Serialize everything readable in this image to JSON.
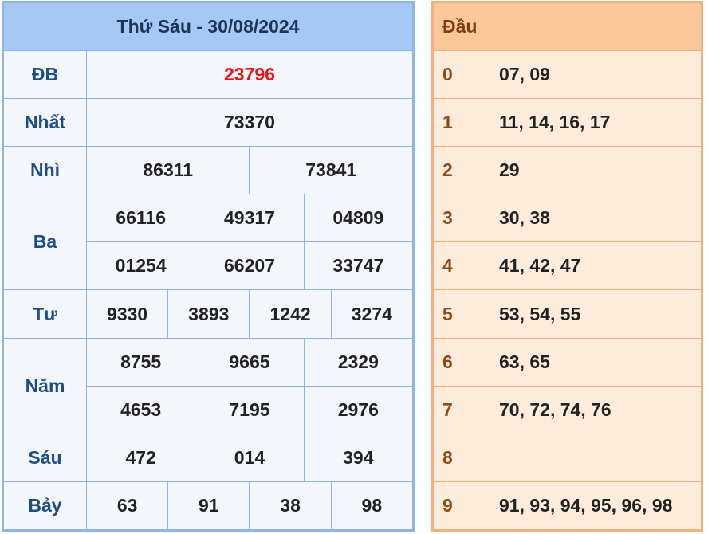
{
  "results": {
    "title": "Thứ Sáu - 30/08/2024",
    "db": {
      "label": "ĐB",
      "values": [
        "23796"
      ]
    },
    "nhat": {
      "label": "Nhất",
      "values": [
        "73370"
      ]
    },
    "nhi": {
      "label": "Nhì",
      "values": [
        "86311",
        "73841"
      ]
    },
    "ba": {
      "label": "Ba",
      "row1": [
        "66116",
        "49317",
        "04809"
      ],
      "row2": [
        "01254",
        "66207",
        "33747"
      ]
    },
    "tu": {
      "label": "Tư",
      "values": [
        "9330",
        "3893",
        "1242",
        "3274"
      ]
    },
    "nam": {
      "label": "Năm",
      "row1": [
        "8755",
        "9665",
        "2329"
      ],
      "row2": [
        "4653",
        "7195",
        "2976"
      ]
    },
    "sau": {
      "label": "Sáu",
      "values": [
        "472",
        "014",
        "394"
      ]
    },
    "bay": {
      "label": "Bảy",
      "values": [
        "63",
        "91",
        "38",
        "98"
      ]
    }
  },
  "loto": {
    "header": "Đầu",
    "rows": [
      {
        "head": "0",
        "tail": "07, 09"
      },
      {
        "head": "1",
        "tail": "11, 14, 16, 17"
      },
      {
        "head": "2",
        "tail": "29"
      },
      {
        "head": "3",
        "tail": "30, 38"
      },
      {
        "head": "4",
        "tail": "41, 42, 47"
      },
      {
        "head": "5",
        "tail": "53, 54, 55"
      },
      {
        "head": "6",
        "tail": "63, 65"
      },
      {
        "head": "7",
        "tail": "70, 72, 74, 76"
      },
      {
        "head": "8",
        "tail": ""
      },
      {
        "head": "9",
        "tail": "91, 93, 94, 95, 96, 98"
      }
    ]
  },
  "colors": {
    "special_prize": "#e8141a",
    "results_border": "#8fb4ea",
    "loto_border": "#f2b07d"
  }
}
